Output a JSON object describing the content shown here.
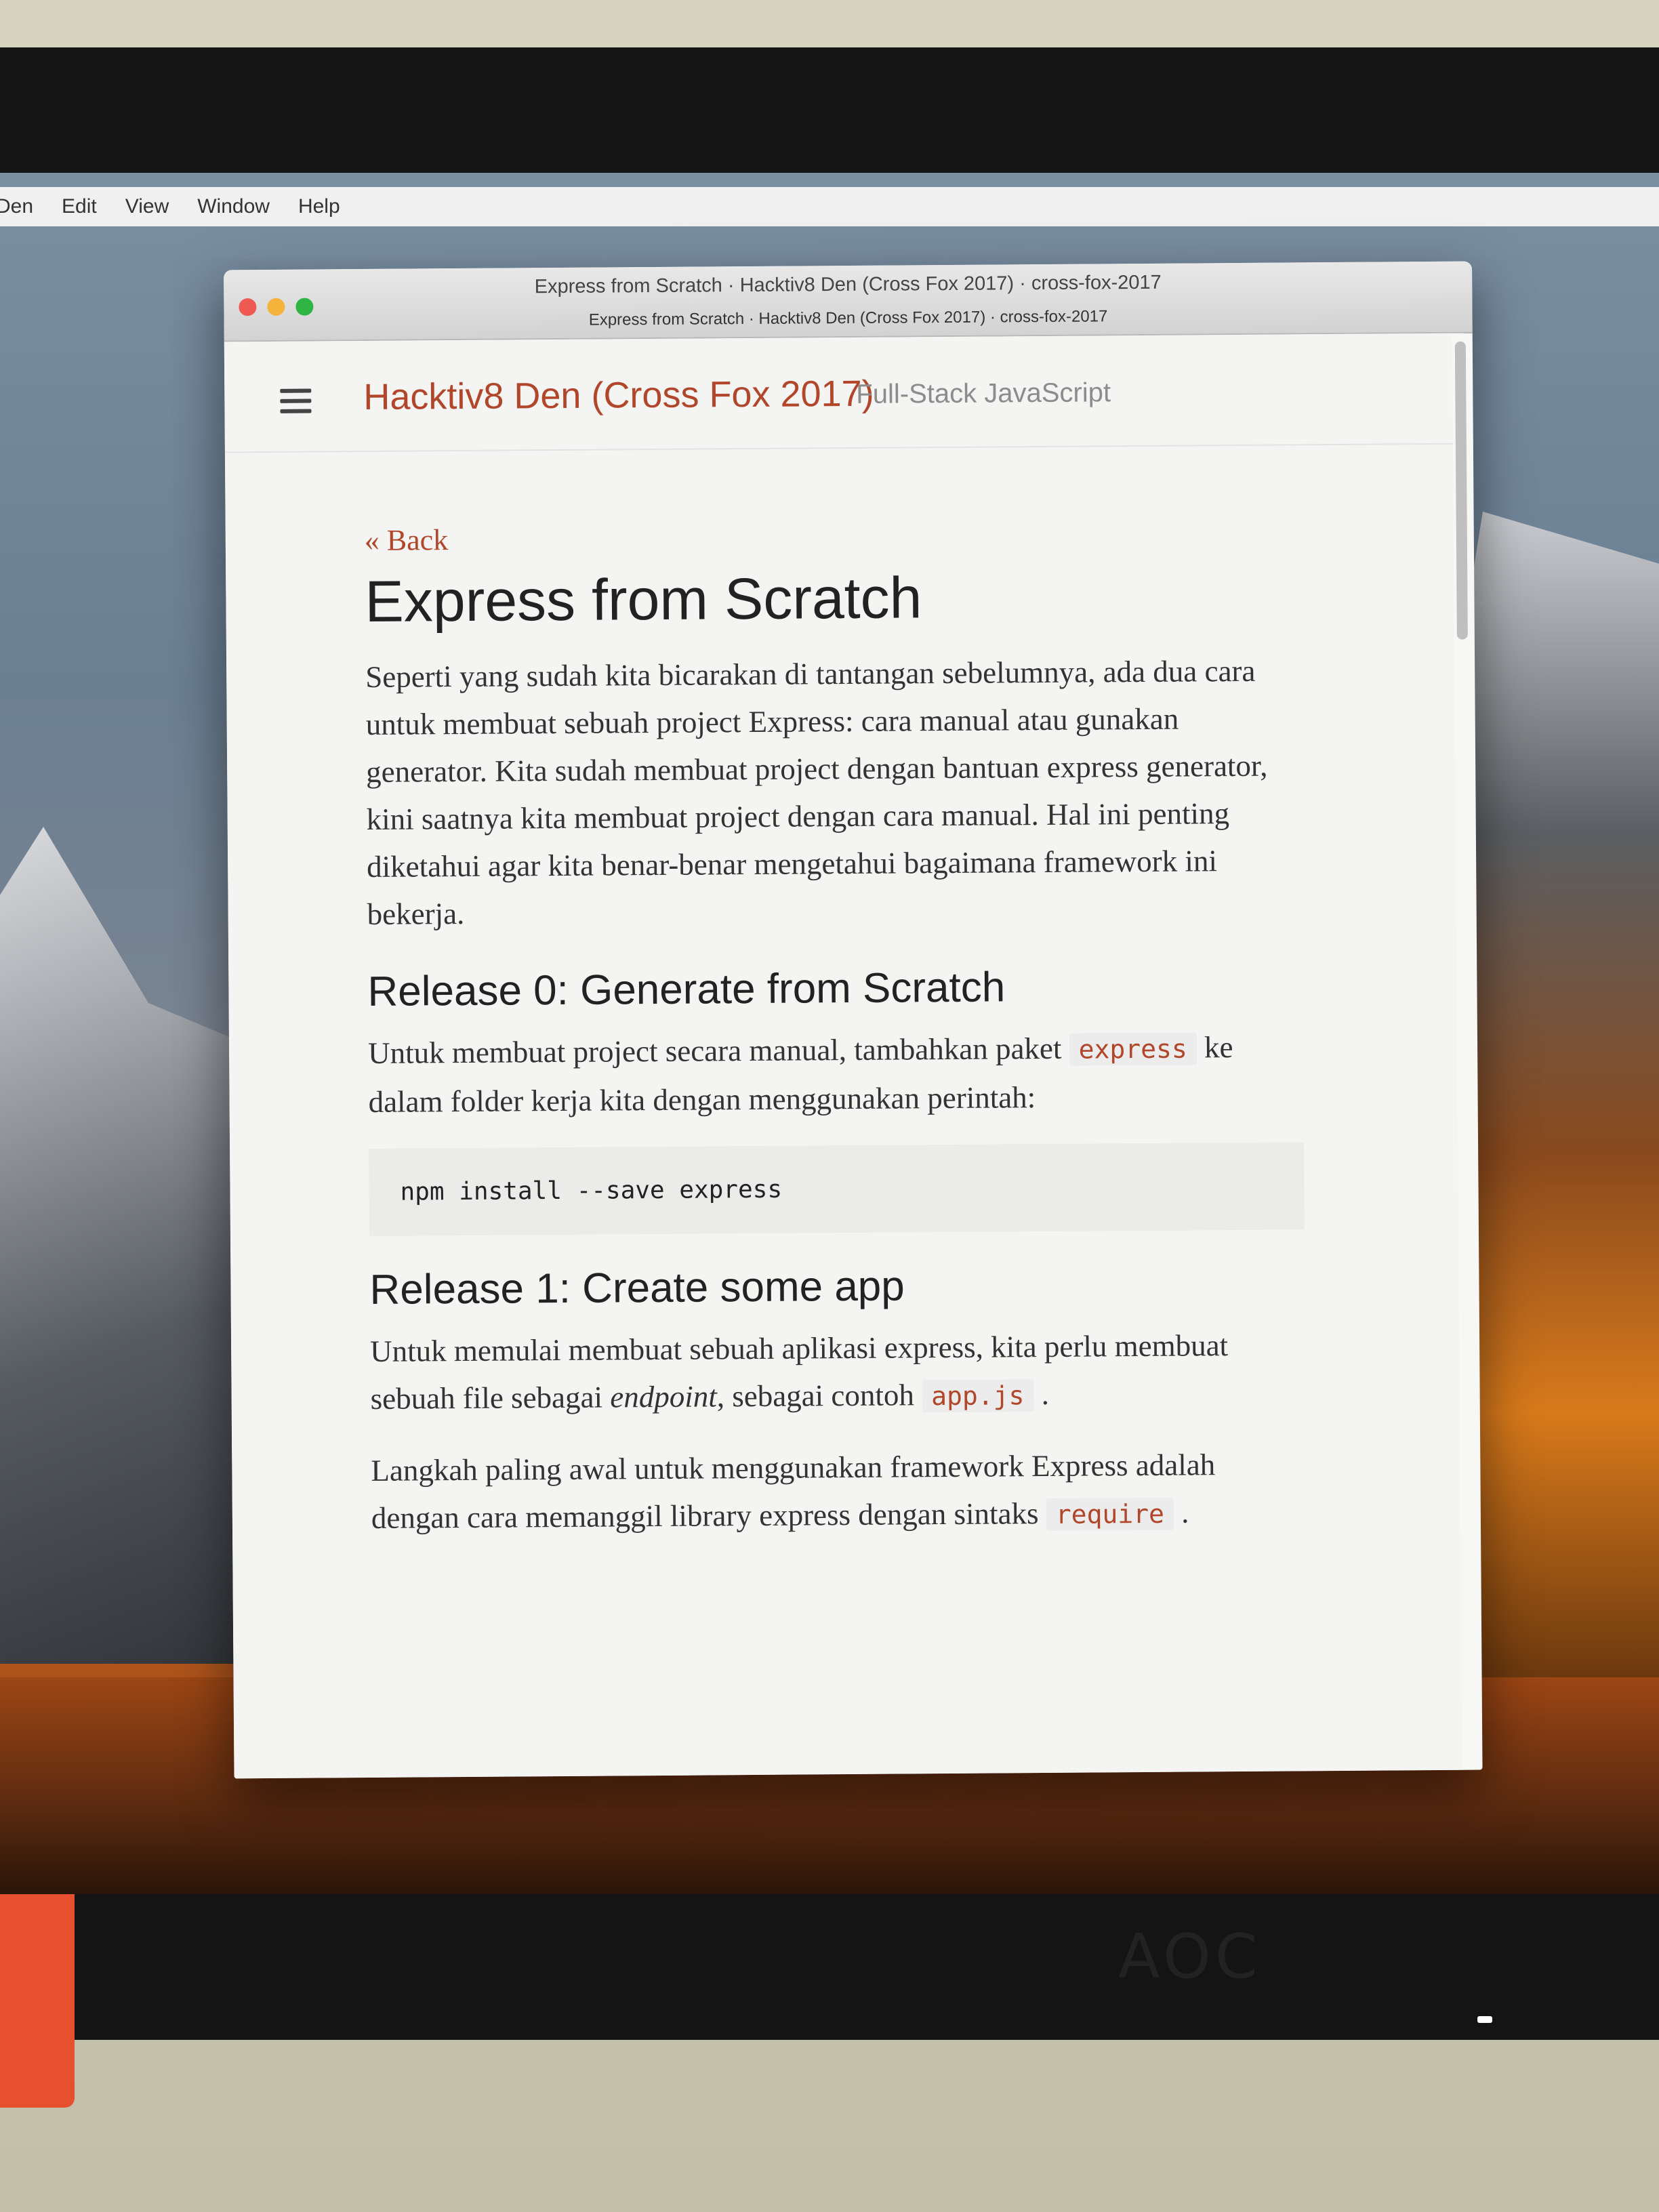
{
  "menubar": {
    "items": [
      "Den",
      "Edit",
      "View",
      "Window",
      "Help"
    ]
  },
  "window": {
    "title": "Express from Scratch · Hacktiv8 Den (Cross Fox 2017) · cross-fox-2017",
    "tab": "Express from Scratch · Hacktiv8 Den (Cross Fox 2017) · cross-fox-2017"
  },
  "header": {
    "brand": "Hacktiv8 Den (Cross Fox 2017)",
    "tagline": "Full-Stack JavaScript"
  },
  "article": {
    "back_link": "« Back",
    "title": "Express from Scratch",
    "intro": "Seperti yang sudah kita bicarakan di tantangan sebelumnya, ada dua cara untuk membuat sebuah project Express: cara manual atau gunakan generator. Kita sudah membuat project dengan bantuan express generator, kini saatnya kita membuat project dengan cara manual. Hal ini penting diketahui agar kita benar-benar mengetahui bagaimana framework ini bekerja.",
    "release0": {
      "heading": "Release 0: Generate from Scratch",
      "p_before": "Untuk membuat project secara manual, tambahkan paket",
      "code": "express",
      "p_after": "ke dalam folder kerja kita dengan menggunakan perintah:",
      "command": "npm install --save express"
    },
    "release1": {
      "heading": "Release 1: Create some app",
      "p1_before": "Untuk memulai membuat sebuah aplikasi express, kita perlu membuat sebuah file sebagai",
      "p1_em": "endpoint",
      "p1_mid": ", sebagai contoh",
      "p1_code": "app.js",
      "p1_end": ".",
      "p2_before": "Langkah paling awal untuk menggunakan framework Express adalah dengan cara memanggil library express dengan sintaks",
      "p2_code": "require",
      "p2_end": "."
    }
  },
  "monitor": {
    "brand": "AOC"
  }
}
